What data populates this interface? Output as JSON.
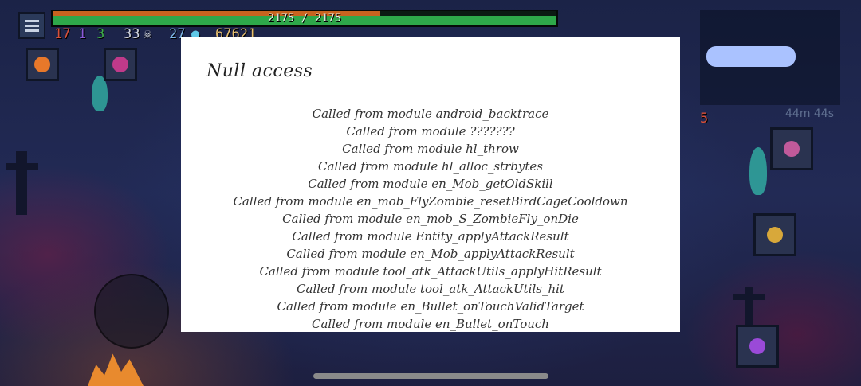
{
  "hud": {
    "menu_icon": "hamburger-menu-icon",
    "health": {
      "current": 2175,
      "max": 2175,
      "text": "2175 / 2175",
      "fraction": 1.0
    },
    "stats": {
      "brutality": "17",
      "tactics": "1",
      "survival": "3",
      "kills": "33",
      "cells": "27",
      "gold": "67621"
    },
    "curse_count": "5",
    "timer": "44m 44s",
    "colors": {
      "health_fill": "#2ea84a",
      "brutality": "#d8503a",
      "tactics": "#8a5ad8",
      "survival": "#3fb04a"
    }
  },
  "dialog": {
    "title": "Null access",
    "trace": [
      "Called from module android_backtrace",
      "Called from module ???????",
      "Called from module hl_throw",
      "Called from module hl_alloc_strbytes",
      "Called from module en_Mob_getOldSkill",
      "Called from module en_mob_FlyZombie_resetBirdCageCooldown",
      "Called from module en_mob_S_ZombieFly_onDie",
      "Called from module Entity_applyAttackResult",
      "Called from module en_Mob_applyAttackResult",
      "Called from module tool_atk_AttackUtils_applyHitResult",
      "Called from module tool_atk_AttackUtils_hit",
      "Called from module en_Bullet_onTouchValidTarget",
      "Called from module en_Bullet_onTouch"
    ]
  }
}
